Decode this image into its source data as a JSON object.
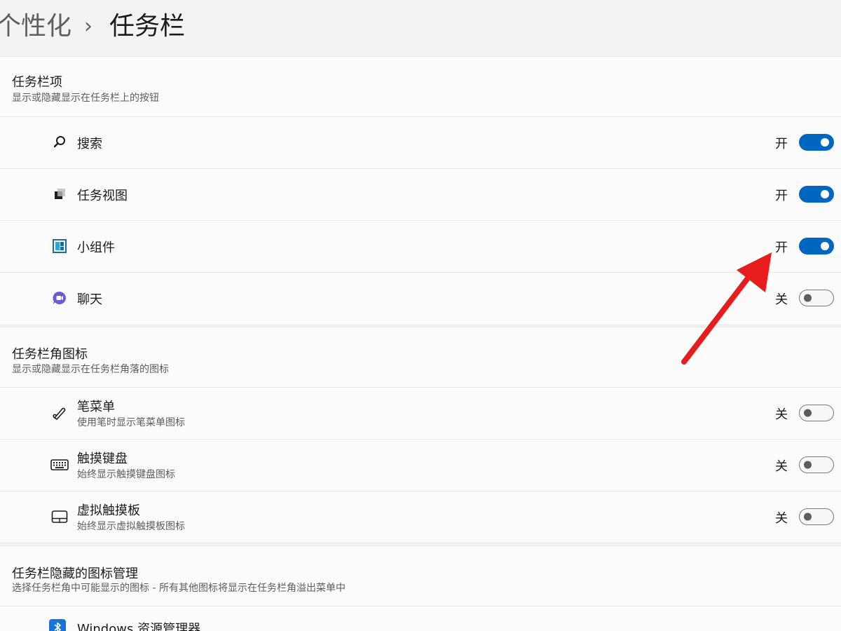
{
  "breadcrumb": {
    "parent": "个性化",
    "separator": "›",
    "current": "任务栏"
  },
  "taskbar_items": {
    "title": "任务栏项",
    "subtitle": "显示或隐藏显示在任务栏上的按钮",
    "items": [
      {
        "label": "搜索",
        "state_label": "开",
        "on": true,
        "icon": "search-icon"
      },
      {
        "label": "任务视图",
        "state_label": "开",
        "on": true,
        "icon": "task-view-icon"
      },
      {
        "label": "小组件",
        "state_label": "开",
        "on": true,
        "icon": "widgets-icon"
      },
      {
        "label": "聊天",
        "state_label": "关",
        "on": false,
        "icon": "chat-icon"
      }
    ]
  },
  "corner_icons": {
    "title": "任务栏角图标",
    "subtitle": "显示或隐藏显示在任务栏角落的图标",
    "items": [
      {
        "label": "笔菜单",
        "sub": "使用笔时显示笔菜单图标",
        "state_label": "关",
        "on": false,
        "icon": "pen-icon"
      },
      {
        "label": "触摸键盘",
        "sub": "始终显示触摸键盘图标",
        "state_label": "关",
        "on": false,
        "icon": "keyboard-icon"
      },
      {
        "label": "虚拟触摸板",
        "sub": "始终显示虚拟触摸板图标",
        "state_label": "关",
        "on": false,
        "icon": "touchpad-icon"
      }
    ]
  },
  "overflow": {
    "title": "任务栏隐藏的图标管理",
    "subtitle": "选择任务栏角中可能显示的图标 - 所有其他图标将显示在任务栏角溢出菜单中",
    "items": [
      {
        "label": "Windows 资源管理器",
        "icon": "bluetooth-icon"
      }
    ]
  },
  "colors": {
    "accent": "#0067c0",
    "annotation_arrow": "#e81c1c"
  }
}
